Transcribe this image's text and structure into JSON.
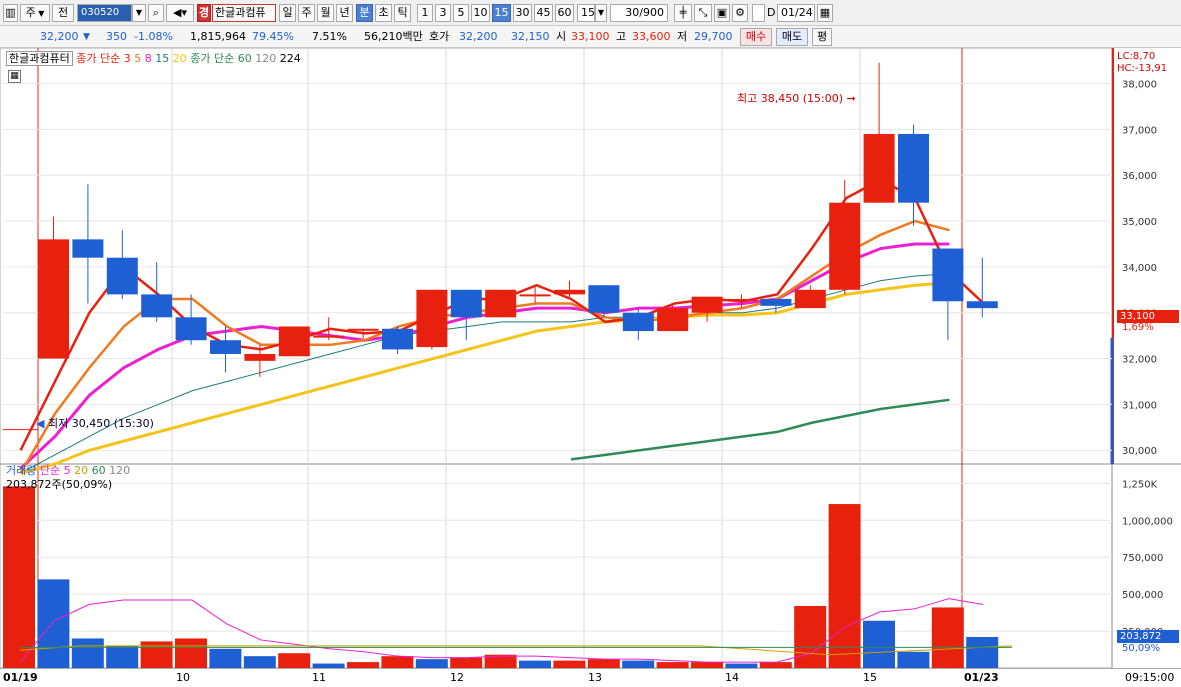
{
  "toolbar": {
    "mode": "주",
    "compare": "전",
    "code": "030520",
    "name": "한글과컴퓨",
    "badge": "경",
    "periods": [
      "일",
      "주",
      "월",
      "년",
      "분",
      "초",
      "틱"
    ],
    "active_period": "분",
    "intervals": [
      "1",
      "3",
      "5",
      "10",
      "15",
      "30",
      "45",
      "60"
    ],
    "active_interval": "15",
    "interval_select": "15",
    "count": "30/900",
    "date": "01/24",
    "check_label": "D"
  },
  "quote": {
    "price": "32,200",
    "change_arrow": "▼",
    "change": "350",
    "change_pct": "-1.08%",
    "volume": "1,815,964",
    "vol_ratio": "79.45%",
    "turnover": "7.51%",
    "amount": "56,210백만",
    "ask_label": "호가",
    "ask": "32,200",
    "bid": "32,150",
    "open_label": "시",
    "open": "33,100",
    "high_label": "고",
    "high": "33,600",
    "low_label": "저",
    "low": "29,700",
    "buy": "매수",
    "sell": "매도",
    "eval": "평"
  },
  "price_legend": {
    "name": "한글과컴퓨터",
    "ma_label": "종가 단순",
    "ma_periods": [
      "3",
      "5",
      "8",
      "15",
      "20"
    ],
    "ma_label2": "종가 단순",
    "ma_periods2": [
      "60",
      "120",
      "224"
    ]
  },
  "lc_hc": {
    "lc": "LC:8,70",
    "hc": "HC:-13,91"
  },
  "annotations": {
    "high": "최고 38,450 (15:00)",
    "low": "최저 30,450 (15:30)"
  },
  "current": {
    "price": "33,100",
    "pct": "1,69%",
    "vol": "203,872",
    "vol_pct": "50,09%"
  },
  "volume_legend": {
    "label": "거래량",
    "ma": "단순",
    "periods": [
      "5",
      "20",
      "60",
      "120"
    ],
    "info": "203,872주(50,09%)"
  },
  "time_axis": [
    "01/19",
    "10",
    "11",
    "12",
    "13",
    "14",
    "15",
    "01/23",
    "09:15:00"
  ],
  "colors": {
    "up": "#e8210f",
    "down": "#1f5fd4",
    "ma3": "#e8210f",
    "ma5": "#f07a1e",
    "ma8": "#ee1fd0",
    "ma15": "#1f7a7a",
    "ma20": "#f6c418",
    "ma60": "#2e8b57"
  },
  "chart_data": [
    {
      "type": "candlestick",
      "title": "한글과컴퓨터 15분봉",
      "ylim": [
        29700,
        38600
      ],
      "yticks": [
        30000,
        31000,
        32000,
        33000,
        34000,
        35000,
        36000,
        37000,
        38000
      ],
      "candles": [
        {
          "o": 32000,
          "h": 35100,
          "l": 32000,
          "c": 34600
        },
        {
          "o": 34600,
          "h": 35800,
          "l": 33200,
          "c": 34200
        },
        {
          "o": 34200,
          "h": 34800,
          "l": 33300,
          "c": 33400
        },
        {
          "o": 33400,
          "h": 34100,
          "l": 32800,
          "c": 32900
        },
        {
          "o": 32900,
          "h": 33400,
          "l": 32300,
          "c": 32400
        },
        {
          "o": 32400,
          "h": 32700,
          "l": 31700,
          "c": 32100
        },
        {
          "o": 31950,
          "h": 32300,
          "l": 31600,
          "c": 32100
        },
        {
          "o": 32050,
          "h": 32700,
          "l": 32050,
          "c": 32700
        },
        {
          "o": 32500,
          "h": 32900,
          "l": 32400,
          "c": 32500
        },
        {
          "o": 32650,
          "h": 32650,
          "l": 32450,
          "c": 32650
        },
        {
          "o": 32650,
          "h": 32700,
          "l": 32100,
          "c": 32200
        },
        {
          "o": 32250,
          "h": 33500,
          "l": 32200,
          "c": 33500
        },
        {
          "o": 33500,
          "h": 33500,
          "l": 32400,
          "c": 32900
        },
        {
          "o": 32900,
          "h": 33500,
          "l": 32900,
          "c": 33500
        },
        {
          "o": 33400,
          "h": 33600,
          "l": 33200,
          "c": 33400
        },
        {
          "o": 33400,
          "h": 33700,
          "l": 33300,
          "c": 33500
        },
        {
          "o": 33600,
          "h": 33600,
          "l": 32900,
          "c": 33000
        },
        {
          "o": 33000,
          "h": 33100,
          "l": 32400,
          "c": 32600
        },
        {
          "o": 32600,
          "h": 33200,
          "l": 32600,
          "c": 33100
        },
        {
          "o": 33000,
          "h": 33300,
          "l": 32800,
          "c": 33350
        },
        {
          "o": 33300,
          "h": 33400,
          "l": 33100,
          "c": 33300
        },
        {
          "o": 33300,
          "h": 33300,
          "l": 33000,
          "c": 33150
        },
        {
          "o": 33100,
          "h": 33600,
          "l": 33100,
          "c": 33500
        },
        {
          "o": 33500,
          "h": 35900,
          "l": 33400,
          "c": 35400
        },
        {
          "o": 35400,
          "h": 38450,
          "l": 35400,
          "c": 36900
        },
        {
          "o": 36900,
          "h": 37100,
          "l": 34900,
          "c": 35400
        },
        {
          "o": 34400,
          "h": 34400,
          "l": 32400,
          "c": 33250
        },
        {
          "o": 33250,
          "h": 34200,
          "l": 32900,
          "c": 33100
        }
      ],
      "ma3": [
        30000,
        31500,
        33000,
        34000,
        33400,
        32700,
        32300,
        32200,
        32400,
        32650,
        32550,
        32600,
        32950,
        33300,
        33300,
        33600,
        33300,
        32800,
        32900,
        33200,
        33300,
        33250,
        33400,
        34400,
        35500,
        35900,
        35500,
        33900,
        33200
      ],
      "ma5": [
        29500,
        30800,
        31800,
        32700,
        33300,
        33300,
        32700,
        32300,
        32300,
        32300,
        32400,
        32700,
        32900,
        33000,
        33100,
        33200,
        33200,
        32900,
        32800,
        32900,
        33000,
        33100,
        33300,
        33800,
        34300,
        34700,
        35000,
        34800
      ],
      "ma8": [
        29600,
        30300,
        31200,
        31800,
        32200,
        32500,
        32600,
        32700,
        32600,
        32500,
        32400,
        32500,
        32700,
        32900,
        33000,
        33100,
        33100,
        33000,
        33100,
        33100,
        33150,
        33200,
        33300,
        33700,
        34100,
        34400,
        34500,
        34500
      ],
      "ma15": [
        29500,
        29900,
        30300,
        30700,
        31000,
        31300,
        31500,
        31700,
        31900,
        32100,
        32300,
        32500,
        32600,
        32700,
        32800,
        32800,
        32800,
        32900,
        32900,
        32900,
        33000,
        33000,
        33100,
        33300,
        33500,
        33700,
        33800,
        33850
      ],
      "ma20": [
        29500,
        29700,
        30000,
        30200,
        30400,
        30600,
        30800,
        31000,
        31200,
        31400,
        31600,
        31800,
        32000,
        32200,
        32400,
        32600,
        32700,
        32800,
        32850,
        32900,
        32950,
        32950,
        33000,
        33200,
        33400,
        33500,
        33600,
        33650
      ],
      "ma60": [
        null,
        null,
        null,
        null,
        null,
        null,
        null,
        null,
        null,
        null,
        null,
        null,
        null,
        null,
        null,
        null,
        29800,
        29900,
        30000,
        30100,
        30200,
        30300,
        30400,
        30600,
        30750,
        30900,
        31000,
        31100
      ]
    },
    {
      "type": "bar",
      "title": "거래량",
      "ylim": [
        0,
        1300000
      ],
      "yticks": [
        250000,
        500000,
        750000,
        1000000,
        1250000
      ],
      "ytick_labels": [
        "250,000",
        "500,000",
        "750,000",
        "1,000,000",
        "1,250K"
      ],
      "values": [
        1230000,
        600000,
        200000,
        150000,
        180000,
        200000,
        130000,
        80000,
        100000,
        30000,
        40000,
        80000,
        60000,
        70000,
        90000,
        50000,
        50000,
        60000,
        50000,
        40000,
        40000,
        30000,
        40000,
        420000,
        1110000,
        320000,
        110000,
        410000,
        210000
      ],
      "direction": [
        "up",
        "down",
        "down",
        "down",
        "up",
        "up",
        "down",
        "down",
        "up",
        "down",
        "up",
        "up",
        "down",
        "up",
        "up",
        "down",
        "up",
        "up",
        "down",
        "up",
        "up",
        "down",
        "up",
        "up",
        "up",
        "down",
        "down",
        "up",
        "down"
      ],
      "ma5": [
        40000,
        320000,
        430000,
        460000,
        460000,
        460000,
        300000,
        190000,
        160000,
        130000,
        110000,
        80000,
        70000,
        70000,
        80000,
        80000,
        70000,
        60000,
        60000,
        50000,
        40000,
        40000,
        40000,
        100000,
        280000,
        380000,
        400000,
        470000,
        430000
      ]
    }
  ]
}
